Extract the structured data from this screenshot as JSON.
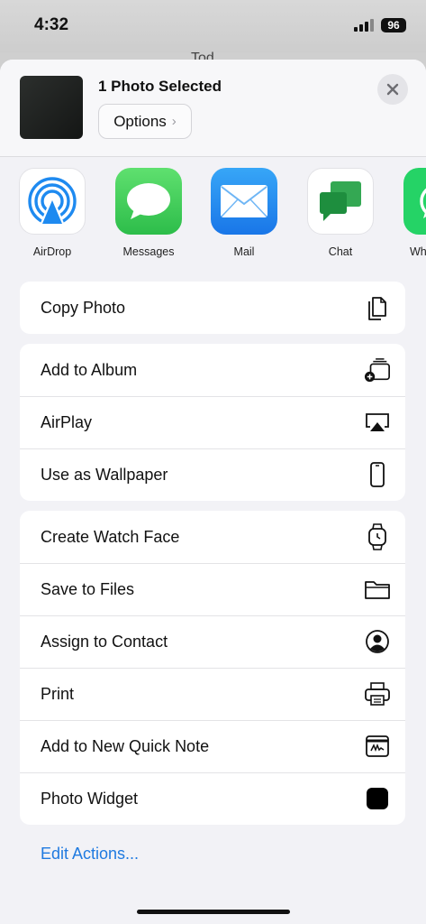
{
  "status_bar": {
    "time": "4:32",
    "battery": "96"
  },
  "background_peek": "Tod",
  "sheet_header": {
    "title": "1 Photo Selected",
    "options_label": "Options",
    "options_chevron": "›"
  },
  "apps": [
    {
      "label": "AirDrop",
      "icon": "airdrop-icon"
    },
    {
      "label": "Messages",
      "icon": "messages-icon"
    },
    {
      "label": "Mail",
      "icon": "mail-icon"
    },
    {
      "label": "Chat",
      "icon": "google-chat-icon"
    },
    {
      "label": "Wh",
      "icon": "whatsapp-icon"
    }
  ],
  "group1": [
    {
      "label": "Copy Photo",
      "icon": "copy-icon"
    }
  ],
  "group2": [
    {
      "label": "Add to Album",
      "icon": "add-to-album-icon"
    },
    {
      "label": "AirPlay",
      "icon": "airplay-icon"
    },
    {
      "label": "Use as Wallpaper",
      "icon": "phone-icon"
    }
  ],
  "group3": [
    {
      "label": "Create Watch Face",
      "icon": "watch-icon"
    },
    {
      "label": "Save to Files",
      "icon": "folder-icon"
    },
    {
      "label": "Assign to Contact",
      "icon": "contact-icon"
    },
    {
      "label": "Print",
      "icon": "printer-icon"
    },
    {
      "label": "Add to New Quick Note",
      "icon": "quick-note-icon"
    },
    {
      "label": "Photo Widget",
      "icon": "photo-widget-icon"
    }
  ],
  "edit_actions": "Edit Actions...",
  "colors": {
    "accent": "#1f7ae0",
    "messages_green": "#34c759",
    "mail_blue": "#1e88f0",
    "chat_green": "#1e9e57",
    "whatsapp_green": "#25d366"
  }
}
